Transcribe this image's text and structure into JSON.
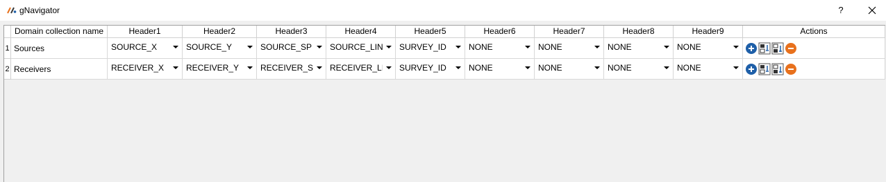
{
  "window": {
    "title": "gNavigator",
    "help_label": "?"
  },
  "table": {
    "headers": [
      "Domain collection name",
      "Header1",
      "Header2",
      "Header3",
      "Header4",
      "Header5",
      "Header6",
      "Header7",
      "Header8",
      "Header9",
      "Actions"
    ],
    "rows": [
      {
        "index": "1",
        "name": "Sources",
        "values": [
          "SOURCE_X",
          "SOURCE_Y",
          "SOURCE_SP",
          "SOURCE_LINE",
          "SURVEY_ID",
          "NONE",
          "NONE",
          "NONE",
          "NONE"
        ]
      },
      {
        "index": "2",
        "name": "Receivers",
        "values": [
          "RECEIVER_X",
          "RECEIVER_Y",
          "RECEIVER_SP",
          "RECEIVER_LINE",
          "SURVEY_ID",
          "NONE",
          "NONE",
          "NONE",
          "NONE"
        ]
      }
    ],
    "action_icons": [
      "add-icon",
      "copy-before-icon",
      "copy-after-icon",
      "remove-icon"
    ]
  },
  "colors": {
    "add_button": "#1e5fa8",
    "remove_button": "#e8711d"
  }
}
